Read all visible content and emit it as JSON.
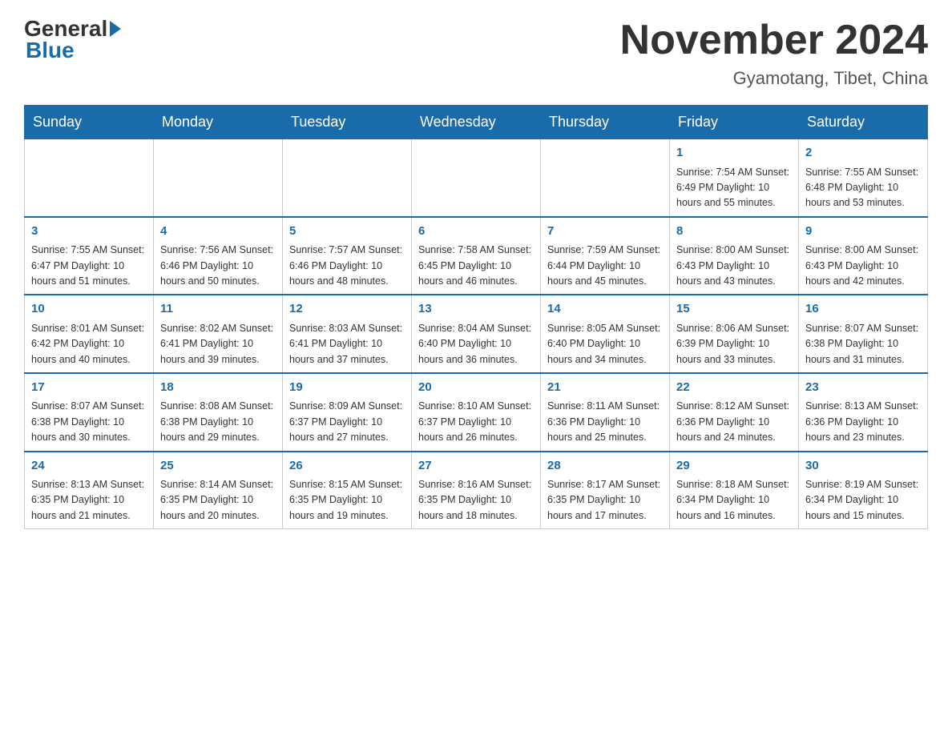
{
  "header": {
    "logo_general": "General",
    "logo_blue": "Blue",
    "month_year": "November 2024",
    "location": "Gyamotang, Tibet, China"
  },
  "weekdays": [
    "Sunday",
    "Monday",
    "Tuesday",
    "Wednesday",
    "Thursday",
    "Friday",
    "Saturday"
  ],
  "weeks": [
    [
      {
        "day": "",
        "info": ""
      },
      {
        "day": "",
        "info": ""
      },
      {
        "day": "",
        "info": ""
      },
      {
        "day": "",
        "info": ""
      },
      {
        "day": "",
        "info": ""
      },
      {
        "day": "1",
        "info": "Sunrise: 7:54 AM\nSunset: 6:49 PM\nDaylight: 10 hours and 55 minutes."
      },
      {
        "day": "2",
        "info": "Sunrise: 7:55 AM\nSunset: 6:48 PM\nDaylight: 10 hours and 53 minutes."
      }
    ],
    [
      {
        "day": "3",
        "info": "Sunrise: 7:55 AM\nSunset: 6:47 PM\nDaylight: 10 hours and 51 minutes."
      },
      {
        "day": "4",
        "info": "Sunrise: 7:56 AM\nSunset: 6:46 PM\nDaylight: 10 hours and 50 minutes."
      },
      {
        "day": "5",
        "info": "Sunrise: 7:57 AM\nSunset: 6:46 PM\nDaylight: 10 hours and 48 minutes."
      },
      {
        "day": "6",
        "info": "Sunrise: 7:58 AM\nSunset: 6:45 PM\nDaylight: 10 hours and 46 minutes."
      },
      {
        "day": "7",
        "info": "Sunrise: 7:59 AM\nSunset: 6:44 PM\nDaylight: 10 hours and 45 minutes."
      },
      {
        "day": "8",
        "info": "Sunrise: 8:00 AM\nSunset: 6:43 PM\nDaylight: 10 hours and 43 minutes."
      },
      {
        "day": "9",
        "info": "Sunrise: 8:00 AM\nSunset: 6:43 PM\nDaylight: 10 hours and 42 minutes."
      }
    ],
    [
      {
        "day": "10",
        "info": "Sunrise: 8:01 AM\nSunset: 6:42 PM\nDaylight: 10 hours and 40 minutes."
      },
      {
        "day": "11",
        "info": "Sunrise: 8:02 AM\nSunset: 6:41 PM\nDaylight: 10 hours and 39 minutes."
      },
      {
        "day": "12",
        "info": "Sunrise: 8:03 AM\nSunset: 6:41 PM\nDaylight: 10 hours and 37 minutes."
      },
      {
        "day": "13",
        "info": "Sunrise: 8:04 AM\nSunset: 6:40 PM\nDaylight: 10 hours and 36 minutes."
      },
      {
        "day": "14",
        "info": "Sunrise: 8:05 AM\nSunset: 6:40 PM\nDaylight: 10 hours and 34 minutes."
      },
      {
        "day": "15",
        "info": "Sunrise: 8:06 AM\nSunset: 6:39 PM\nDaylight: 10 hours and 33 minutes."
      },
      {
        "day": "16",
        "info": "Sunrise: 8:07 AM\nSunset: 6:38 PM\nDaylight: 10 hours and 31 minutes."
      }
    ],
    [
      {
        "day": "17",
        "info": "Sunrise: 8:07 AM\nSunset: 6:38 PM\nDaylight: 10 hours and 30 minutes."
      },
      {
        "day": "18",
        "info": "Sunrise: 8:08 AM\nSunset: 6:38 PM\nDaylight: 10 hours and 29 minutes."
      },
      {
        "day": "19",
        "info": "Sunrise: 8:09 AM\nSunset: 6:37 PM\nDaylight: 10 hours and 27 minutes."
      },
      {
        "day": "20",
        "info": "Sunrise: 8:10 AM\nSunset: 6:37 PM\nDaylight: 10 hours and 26 minutes."
      },
      {
        "day": "21",
        "info": "Sunrise: 8:11 AM\nSunset: 6:36 PM\nDaylight: 10 hours and 25 minutes."
      },
      {
        "day": "22",
        "info": "Sunrise: 8:12 AM\nSunset: 6:36 PM\nDaylight: 10 hours and 24 minutes."
      },
      {
        "day": "23",
        "info": "Sunrise: 8:13 AM\nSunset: 6:36 PM\nDaylight: 10 hours and 23 minutes."
      }
    ],
    [
      {
        "day": "24",
        "info": "Sunrise: 8:13 AM\nSunset: 6:35 PM\nDaylight: 10 hours and 21 minutes."
      },
      {
        "day": "25",
        "info": "Sunrise: 8:14 AM\nSunset: 6:35 PM\nDaylight: 10 hours and 20 minutes."
      },
      {
        "day": "26",
        "info": "Sunrise: 8:15 AM\nSunset: 6:35 PM\nDaylight: 10 hours and 19 minutes."
      },
      {
        "day": "27",
        "info": "Sunrise: 8:16 AM\nSunset: 6:35 PM\nDaylight: 10 hours and 18 minutes."
      },
      {
        "day": "28",
        "info": "Sunrise: 8:17 AM\nSunset: 6:35 PM\nDaylight: 10 hours and 17 minutes."
      },
      {
        "day": "29",
        "info": "Sunrise: 8:18 AM\nSunset: 6:34 PM\nDaylight: 10 hours and 16 minutes."
      },
      {
        "day": "30",
        "info": "Sunrise: 8:19 AM\nSunset: 6:34 PM\nDaylight: 10 hours and 15 minutes."
      }
    ]
  ]
}
